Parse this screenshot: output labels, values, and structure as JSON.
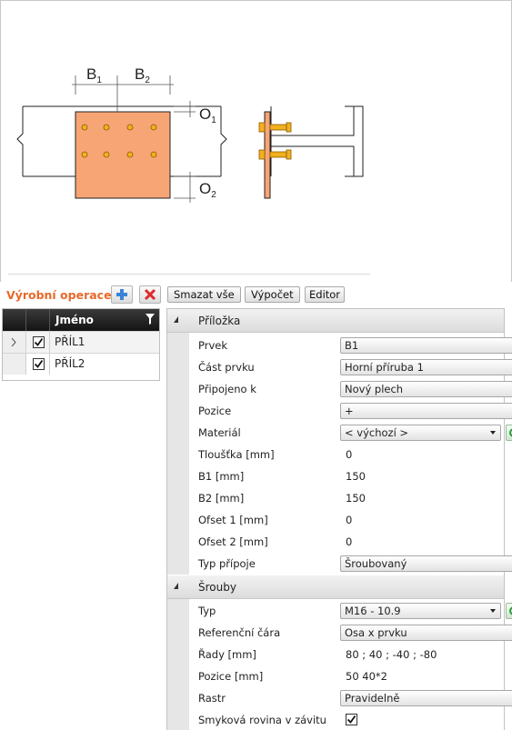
{
  "diagram": {
    "label_b1": "B",
    "label_b1_sub": "1",
    "label_b2": "B",
    "label_b2_sub": "2",
    "label_o1": "O",
    "label_o1_sub": "1",
    "label_o2": "O",
    "label_o2_sub": "2"
  },
  "toolbar": {
    "title": "Výrobní operace",
    "add_icon": "plus-icon",
    "delete_icon": "red-x-icon",
    "delete_all_label": "Smazat vše",
    "compute_label": "Výpočet",
    "editor_label": "Editor"
  },
  "grid": {
    "column_name": "Jméno",
    "filter_icon": "filter-icon",
    "rows": [
      {
        "name": "PŘÍL1",
        "checked": true,
        "current": true
      },
      {
        "name": "PŘÍL2",
        "checked": true,
        "current": false
      }
    ]
  },
  "props": {
    "plate": {
      "title": "Příložka",
      "prvek_label": "Prvek",
      "prvek_value": "B1",
      "cast_label": "Část prvku",
      "cast_value": "Horní příruba 1",
      "pripojeno_label": "Připojeno k",
      "pripojeno_value": "Nový plech",
      "pozice_label": "Pozice",
      "pozice_value": "+",
      "material_label": "Materiál",
      "material_value": "< výchozí >",
      "tloustka_label": "Tloušťka [mm]",
      "tloustka_value": "0",
      "b1_label": "B1 [mm]",
      "b1_value": "150",
      "b2_label": "B2 [mm]",
      "b2_value": "150",
      "ofset1_label": "Ofset 1 [mm]",
      "ofset1_value": "0",
      "ofset2_label": "Ofset 2 [mm]",
      "ofset2_value": "0",
      "typ_label": "Typ přípoje",
      "typ_value": "Šroubovaný"
    },
    "bolts": {
      "title": "Šrouby",
      "typ_label": "Typ",
      "typ_value": "M16 - 10.9",
      "ref_label": "Referenční čára",
      "ref_value": "Osa x prvku",
      "rady_label": "Řady [mm]",
      "rady_value": "80 ; 40 ; -40 ; -80",
      "pozice_label": "Pozice [mm]",
      "pozice_value": "50 40*2",
      "rastr_label": "Rastr",
      "rastr_value": "Pravidelně",
      "smyk_label": "Smyková rovina v závitu",
      "smyk_checked": true
    }
  },
  "colors": {
    "accent": "#e8682a",
    "plate_fill": "#f7a574",
    "bolt_fill": "#f2b01e"
  }
}
